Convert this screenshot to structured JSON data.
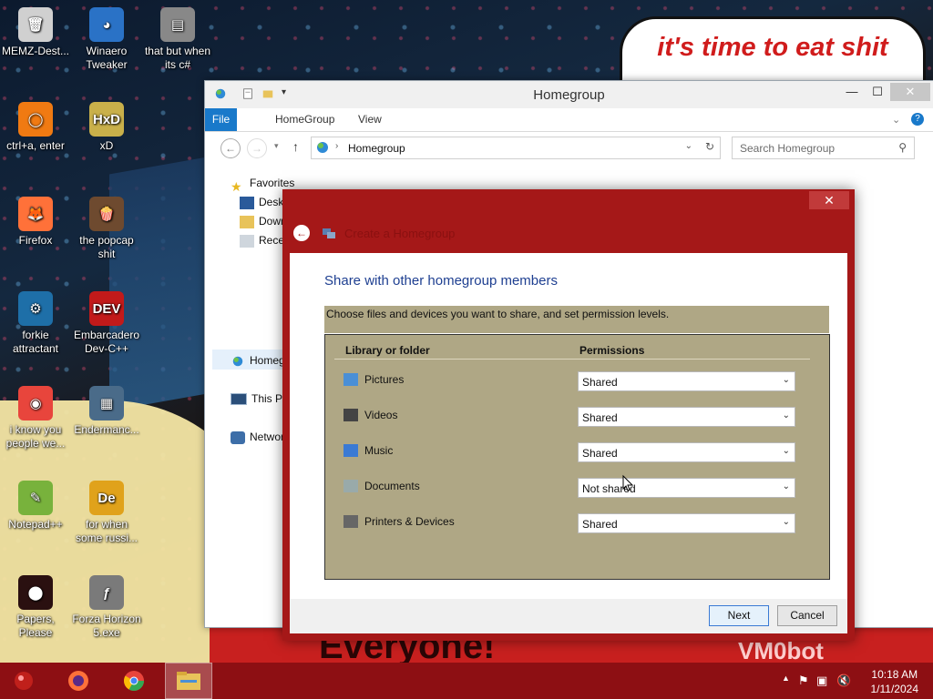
{
  "desktop": {
    "wallpaper_text": {
      "bubble": "it's time to eat shit",
      "banner": "Everyone!",
      "corner": "VM0bot"
    },
    "icons": [
      {
        "name": "memz-destructive-icon",
        "label": "MEMZ-Dest...",
        "color": "#d0d0d0",
        "glyph": "🗑"
      },
      {
        "name": "winaero-tweaker-icon",
        "label": "Winaero Tweaker",
        "color": "#2a72c6",
        "glyph": "◕"
      },
      {
        "name": "that-but-when-icon",
        "label": "that but when its c#",
        "color": "#888888",
        "glyph": "▤"
      },
      {
        "name": "ctrl-a-enter-icon",
        "label": "ctrl+a, enter",
        "color": "#f07a12",
        "glyph": "◯"
      },
      {
        "name": "xd-icon",
        "label": "xD",
        "color": "#c9b04a",
        "glyph": "HxD"
      },
      {
        "name": "firefox-icon",
        "label": "Firefox",
        "color": "#ff7139",
        "glyph": "🦊"
      },
      {
        "name": "popcap-icon",
        "label": "the popcap shit",
        "color": "#6e4a2f",
        "glyph": "🍿"
      },
      {
        "name": "forkie-icon",
        "label": "forkie attractant",
        "color": "#1e6fa8",
        "glyph": "⚙"
      },
      {
        "name": "devcpp-icon",
        "label": "Embarcadero Dev-C++",
        "color": "#c21a1a",
        "glyph": "DEV"
      },
      {
        "name": "chrome-desktop-icon",
        "label": "i know you people we...",
        "color": "#e8453c",
        "glyph": "◉"
      },
      {
        "name": "endermanch-icon",
        "label": "Endermanc...",
        "color": "#4a6b89",
        "glyph": "▦"
      },
      {
        "name": "notepadpp-icon",
        "label": "Notepad++",
        "color": "#78b23c",
        "glyph": "✎"
      },
      {
        "name": "for-when-icon",
        "label": "for when some russi...",
        "color": "#e0a21b",
        "glyph": "De"
      },
      {
        "name": "papers-please-icon",
        "label": "Papers, Please",
        "color": "#2a1010",
        "glyph": "⬤"
      },
      {
        "name": "forza-icon",
        "label": "Forza Horizon 5.exe",
        "color": "#7a7a7a",
        "glyph": "ƒ"
      }
    ]
  },
  "explorer": {
    "title": "Homegroup",
    "ribbon_tabs": [
      "File",
      "HomeGroup",
      "View"
    ],
    "address": "Homegroup",
    "search_placeholder": "Search Homegroup",
    "nav": {
      "favorites": "Favorites",
      "desktop": "Deskt",
      "downloads": "Down",
      "recent": "Recen",
      "homegroup": "Homeg",
      "this_pc": "This PC",
      "network": "Networ"
    }
  },
  "dialog": {
    "heading": "Create a Homegroup",
    "title": "Share with other homegroup members",
    "instruction": "Choose files and devices you want to share, and set permission levels.",
    "col_library": "Library or folder",
    "col_permissions": "Permissions",
    "rows": [
      {
        "label": "Pictures",
        "permission": "Shared",
        "icon": "pictures-icon"
      },
      {
        "label": "Videos",
        "permission": "Shared",
        "icon": "videos-icon"
      },
      {
        "label": "Music",
        "permission": "Shared",
        "icon": "music-icon"
      },
      {
        "label": "Documents",
        "permission": "Not shared",
        "icon": "documents-icon"
      },
      {
        "label": "Printers & Devices",
        "permission": "Shared",
        "icon": "printer-icon"
      }
    ],
    "next_label": "Next",
    "cancel_label": "Cancel"
  },
  "taskbar": {
    "clock_time": "10:18 AM",
    "clock_date": "1/11/2024"
  },
  "colors": {
    "accent": "#1979ca",
    "dialog_frame": "#a51818",
    "taskbar": "#8d0f13",
    "share_panel": "#afa785"
  }
}
